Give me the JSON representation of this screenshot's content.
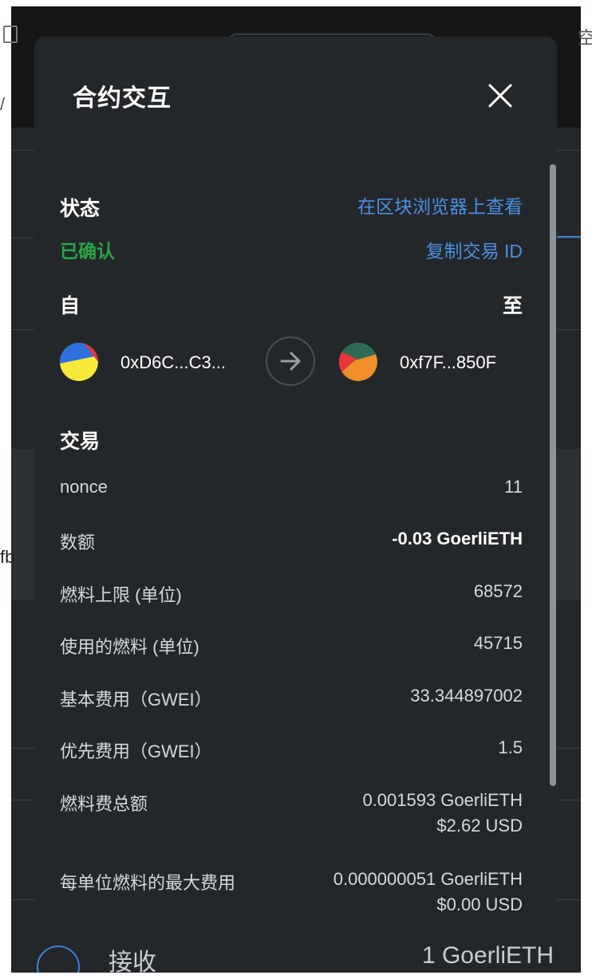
{
  "background": {
    "fragment_top_left": "/",
    "fragment_left_mid": "fb",
    "fragment_top_right": "空",
    "receive_label": "接收",
    "receive_amount": "1 GoerliETH"
  },
  "modal": {
    "title": "合约交互",
    "status_label": "状态",
    "status_value": "已确认",
    "view_on_explorer": "在区块浏览器上查看",
    "copy_tx_id": "复制交易 ID",
    "from_label": "自",
    "to_label": "至",
    "from_address": "0xD6C...C3...",
    "to_address": "0xf7F...850F",
    "transaction_label": "交易",
    "rows": [
      {
        "key": "nonce",
        "value": "11"
      },
      {
        "key": "数额",
        "value": "-0.03 GoerliETH"
      },
      {
        "key": "燃料上限 (单位)",
        "value": "68572"
      },
      {
        "key": "使用的燃料 (单位)",
        "value": "45715"
      },
      {
        "key": "基本费用（GWEI）",
        "value": "33.344897002"
      },
      {
        "key": "优先费用（GWEI）",
        "value": "1.5"
      },
      {
        "key": "燃料费总额",
        "value": "0.001593 GoerliETH",
        "value2": "$2.62 USD"
      },
      {
        "key": "每单位燃料的最大费用",
        "value": "0.000000051 GoerliETH",
        "value2": "$0.00 USD"
      }
    ]
  },
  "colors": {
    "modal_bg": "#24272a",
    "link": "#4a90e2",
    "success": "#28a745",
    "text": "#d6d9dc"
  },
  "icons": {
    "close": "close-icon",
    "arrow": "arrow-right-icon"
  }
}
